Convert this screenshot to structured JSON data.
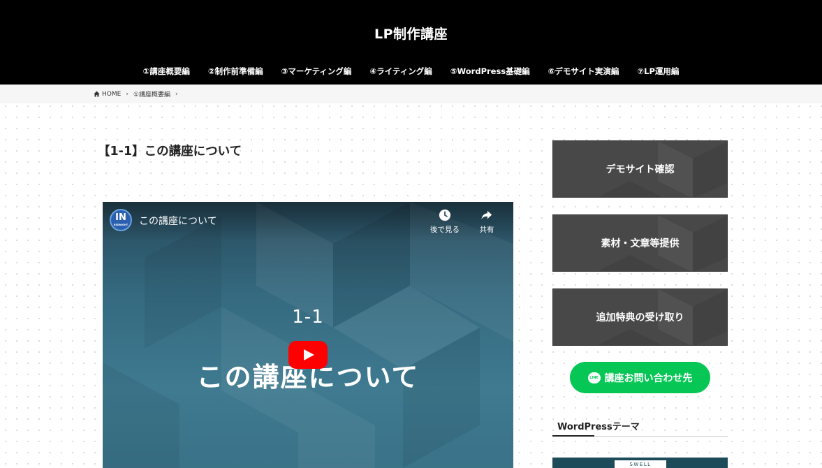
{
  "site": {
    "title": "LP制作講座"
  },
  "nav": {
    "items": [
      "①講座概要編",
      "②制作前準備編",
      "③マーケティング編",
      "④ライティング編",
      "⑤WordPress基礎編",
      "⑥デモサイト実演編",
      "⑦LP運用編"
    ]
  },
  "breadcrumb": {
    "home": "HOME",
    "current": "①講座概要編"
  },
  "article": {
    "title": "【1-1】この講座について"
  },
  "video": {
    "channel_initial": "IN",
    "channel_name": "REDNIGHT",
    "title": "この講座について",
    "watch_later": "後で見る",
    "share": "共有",
    "number": "1-1",
    "headline": "この講座について"
  },
  "sidebar": {
    "banners": [
      "デモサイト確認",
      "素材・文章等提供",
      "追加特典の受け取り"
    ],
    "line_button": "講座お問い合わせ先",
    "line_logo": "LINE",
    "widget_title": "WordPressテーマ",
    "swell_label": "SWELL"
  },
  "colors": {
    "header": "#000000",
    "line_green": "#06c755",
    "yt_red": "#ff0000",
    "banner": "#484848"
  }
}
